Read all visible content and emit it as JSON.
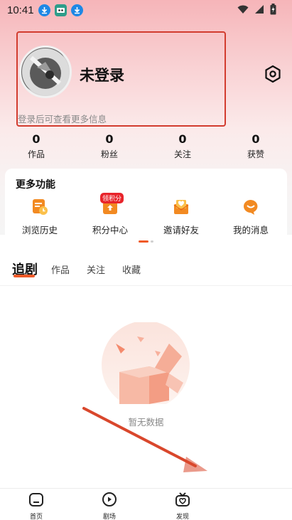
{
  "status_bar": {
    "time": "10:41",
    "icons": [
      "download-icon",
      "app-icon",
      "download-icon",
      "wifi-icon",
      "signal-icon",
      "battery-icon"
    ]
  },
  "profile": {
    "title": "未登录",
    "subtitle": "登录后可查看更多信息",
    "avatar_icon": "avatar-placeholder-icon",
    "settings_icon": "settings-icon"
  },
  "stats": [
    {
      "value": "0",
      "label": "作品"
    },
    {
      "value": "0",
      "label": "粉丝"
    },
    {
      "value": "0",
      "label": "关注"
    },
    {
      "value": "0",
      "label": "获赞"
    }
  ],
  "more_functions": {
    "title": "更多功能",
    "items": [
      {
        "label": "浏览历史",
        "icon": "history-icon"
      },
      {
        "label": "积分中心",
        "icon": "points-icon",
        "badge": "领积分"
      },
      {
        "label": "邀请好友",
        "icon": "invite-icon"
      },
      {
        "label": "我的消息",
        "icon": "message-icon"
      }
    ]
  },
  "tabs": [
    {
      "label": "追剧",
      "active": true
    },
    {
      "label": "作品",
      "active": false
    },
    {
      "label": "关注",
      "active": false
    },
    {
      "label": "收藏",
      "active": false
    }
  ],
  "empty_state": {
    "text": "暂无数据"
  },
  "bottom_nav": [
    {
      "label": "首页",
      "icon": "home-icon"
    },
    {
      "label": "剧场",
      "icon": "theater-icon"
    },
    {
      "label": "发现",
      "icon": "discover-icon"
    }
  ],
  "colors": {
    "accent": "#f05a28",
    "highlight_box": "#d23c2f",
    "annotation_arrow": "#d9472c"
  }
}
